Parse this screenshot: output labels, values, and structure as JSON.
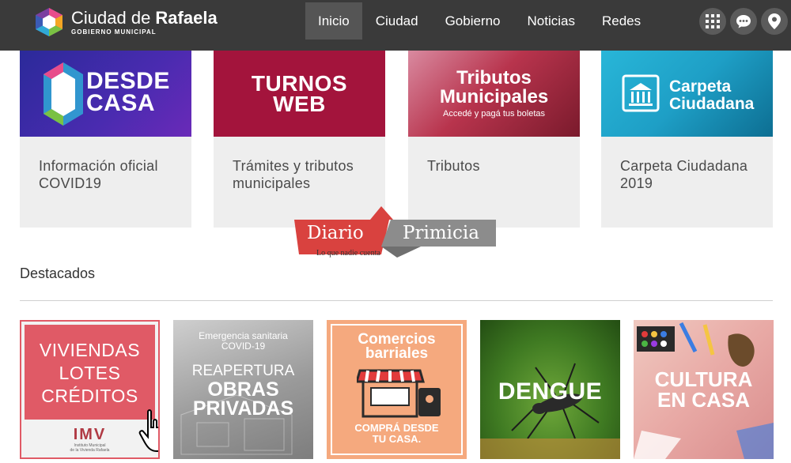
{
  "header": {
    "logo_title_light": "Ciudad de ",
    "logo_title_bold": "Rafaela",
    "logo_subtitle": "GOBIERNO MUNICIPAL",
    "nav": [
      "Inicio",
      "Ciudad",
      "Gobierno",
      "Noticias",
      "Redes"
    ],
    "icons": [
      "apps-grid-icon",
      "chat-bubble-icon",
      "location-pin-icon"
    ]
  },
  "cards": [
    {
      "image_line1": "DESDE",
      "image_line2": "CASA",
      "label": "Información oficial COVID19"
    },
    {
      "image_line1": "TURNOS",
      "image_line2": "WEB",
      "label": "Trámites y tributos municipales"
    },
    {
      "image_line1": "Tributos",
      "image_line2": "Municipales",
      "image_sub": "Accedé y pagá tus boletas",
      "label": "Tributos"
    },
    {
      "image_line1": "Carpeta",
      "image_line2": "Ciudadana",
      "label": "Carpeta Ciudadana 2019"
    }
  ],
  "watermark": {
    "left": "Diario",
    "right": "Primicia",
    "tagline": "Lo que nadie cuenta"
  },
  "section": {
    "title": "Destacados"
  },
  "featured": [
    {
      "lines": [
        "VIVIENDAS",
        "LOTES",
        "CRÉDITOS"
      ],
      "logo": "IMV",
      "logo_sub1": "Instituto Municipal",
      "logo_sub2": "de la Vivienda Rafaela"
    },
    {
      "top1": "Emergencia sanitaria",
      "top2": "COVID-19",
      "mid": "REAPERTURA",
      "big1": "OBRAS",
      "big2": "PRIVADAS"
    },
    {
      "title1": "Comercios",
      "title2": "barriales",
      "foot1": "COMPRÁ DESDE",
      "foot2": "TU CASA."
    },
    {
      "title": "DENGUE"
    },
    {
      "title1": "CULTURA",
      "title2": "EN CASA"
    }
  ],
  "colors": {
    "header": "#3a3a3a",
    "card_bg": "#eeeeee",
    "turnos": "#a3143c",
    "desde_casa": "#3c2aa8",
    "carpeta": "#1e9fc6",
    "tributos": "#b8344d"
  }
}
